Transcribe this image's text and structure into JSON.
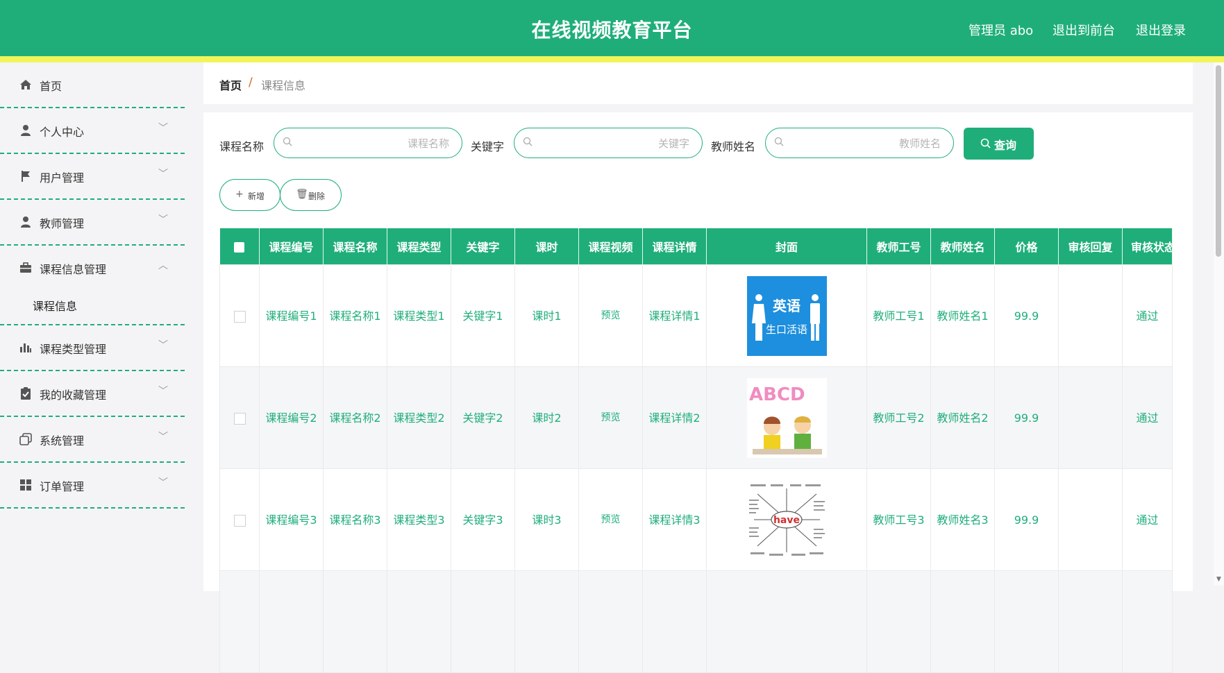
{
  "header": {
    "title": "在线视频教育平台",
    "admin": "管理员 abo",
    "to_front": "退出到前台",
    "logout": "退出登录"
  },
  "sidebar": {
    "items": [
      {
        "label": "首页",
        "icon": "home-icon"
      },
      {
        "label": "个人中心",
        "icon": "person-icon"
      },
      {
        "label": "用户管理",
        "icon": "flag-icon"
      },
      {
        "label": "教师管理",
        "icon": "person-icon"
      },
      {
        "label": "课程信息管理",
        "icon": "briefcase-icon"
      },
      {
        "label": "课程类型管理",
        "icon": "bar-chart-icon"
      },
      {
        "label": "我的收藏管理",
        "icon": "clipboard-check-icon"
      },
      {
        "label": "系统管理",
        "icon": "copy-icon"
      },
      {
        "label": "订单管理",
        "icon": "grid-icon"
      }
    ],
    "sub_active": "课程信息"
  },
  "breadcrumb": {
    "home": "首页",
    "sep": "/",
    "current": "课程信息"
  },
  "filters": {
    "name_label": "课程名称",
    "name_placeholder": "课程名称",
    "keyword_label": "关键字",
    "keyword_placeholder": "关键字",
    "teacher_label": "教师姓名",
    "teacher_placeholder": "教师姓名",
    "query": "查询"
  },
  "actions": {
    "add": "新增",
    "delete": "删除"
  },
  "table": {
    "headers": [
      "课程编号",
      "课程名称",
      "课程类型",
      "关键字",
      "课时",
      "课程视频",
      "课程详情",
      "封面",
      "教师工号",
      "教师姓名",
      "价格",
      "审核回复",
      "审核状态"
    ],
    "rows": [
      {
        "code": "课程编号1",
        "name": "课程名称1",
        "type": "课程类型1",
        "keyword": "关键字1",
        "hours": "课时1",
        "video": "预览",
        "detail": "课程详情1",
        "teacher_no": "教师工号1",
        "teacher_name": "教师姓名1",
        "price": "99.9",
        "reply": "",
        "status": "通过"
      },
      {
        "code": "课程编号2",
        "name": "课程名称2",
        "type": "课程类型2",
        "keyword": "关键字2",
        "hours": "课时2",
        "video": "预览",
        "detail": "课程详情2",
        "teacher_no": "教师工号2",
        "teacher_name": "教师姓名2",
        "price": "99.9",
        "reply": "",
        "status": "通过"
      },
      {
        "code": "课程编号3",
        "name": "课程名称3",
        "type": "课程类型3",
        "keyword": "关键字3",
        "hours": "课时3",
        "video": "预览",
        "detail": "课程详情3",
        "teacher_no": "教师工号3",
        "teacher_name": "教师姓名3",
        "price": "99.9",
        "reply": "",
        "status": "通过"
      }
    ]
  },
  "covers": {
    "cover1_text_top": "英语",
    "cover1_text_bottom": "生口活语",
    "cover2_text": "ABCD",
    "cover3_text": "have"
  },
  "colors": {
    "primary": "#1fae7a",
    "accent_bar": "#f2f55a"
  }
}
